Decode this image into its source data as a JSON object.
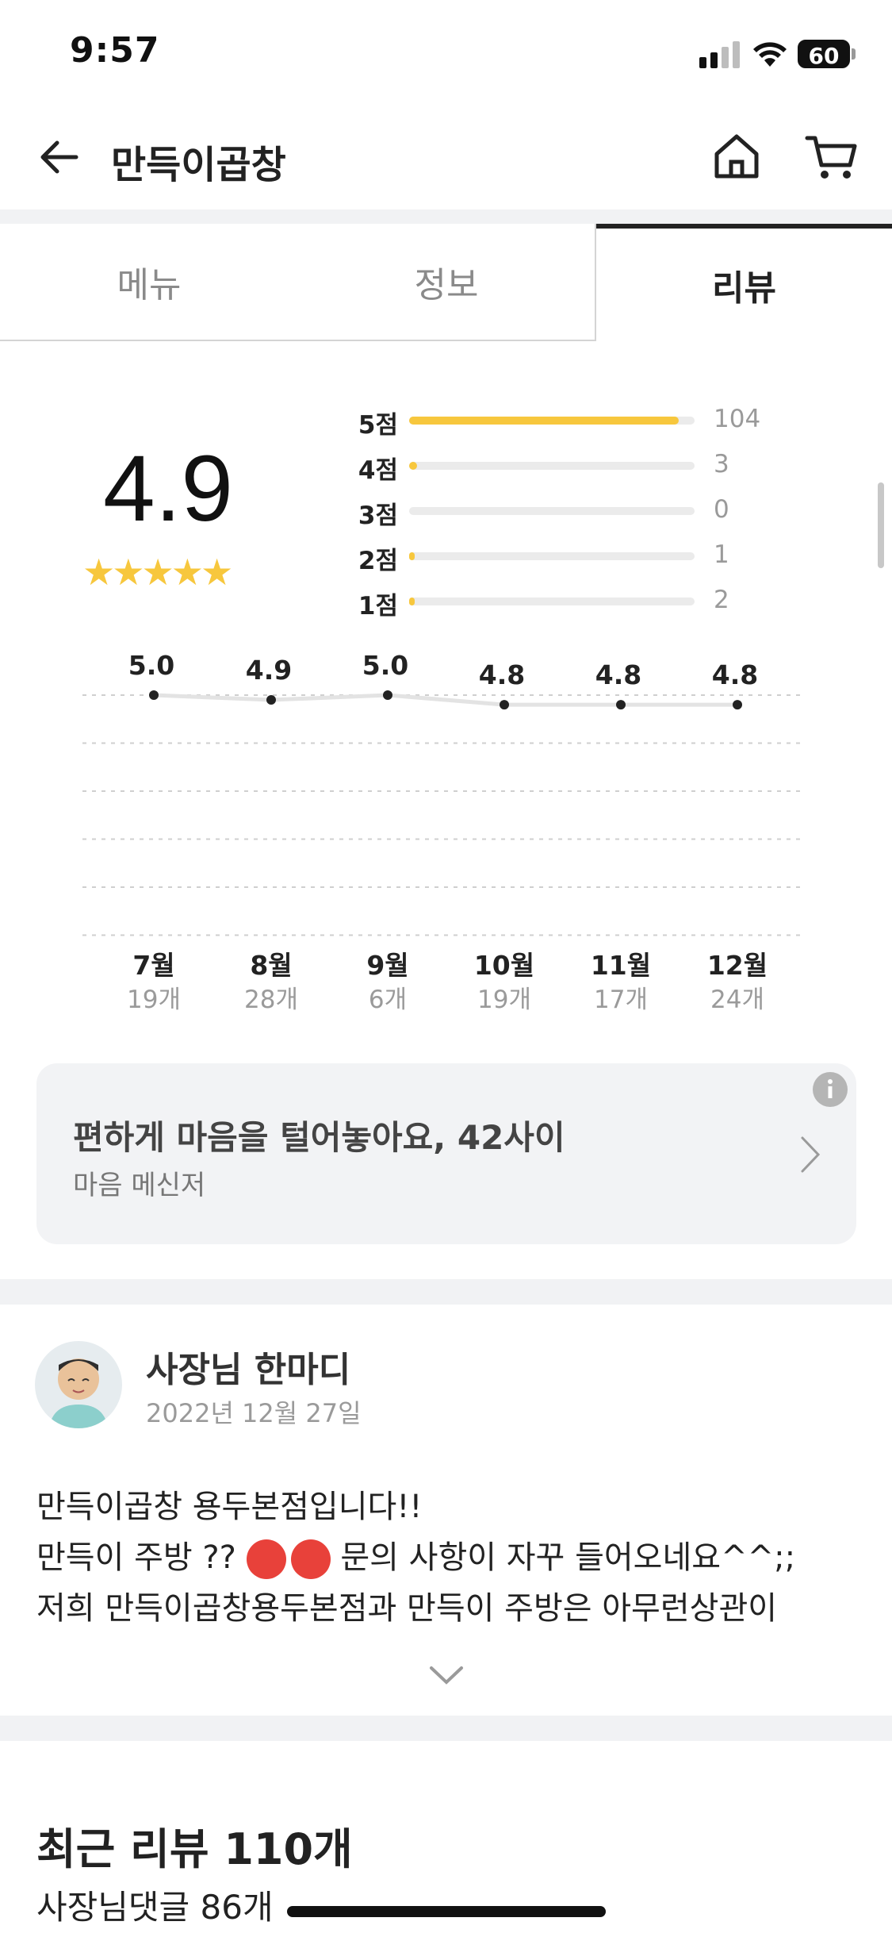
{
  "status_bar": {
    "time": "9:57",
    "battery": "60"
  },
  "header": {
    "title": "만득이곱창"
  },
  "tabs": [
    {
      "label": "메뉴"
    },
    {
      "label": "정보"
    },
    {
      "label": "리뷰"
    }
  ],
  "rating": {
    "score": "4.9",
    "stars": "★★★★★",
    "distribution": [
      {
        "label": "5점",
        "count": "104",
        "fraction": 0.945
      },
      {
        "label": "4점",
        "count": "3",
        "fraction": 0.027
      },
      {
        "label": "3점",
        "count": "0",
        "fraction": 0.0
      },
      {
        "label": "2점",
        "count": "1",
        "fraction": 0.009
      },
      {
        "label": "1점",
        "count": "2",
        "fraction": 0.018
      }
    ]
  },
  "chart_data": {
    "type": "line",
    "title": "",
    "categories": [
      "7월",
      "8월",
      "9월",
      "10월",
      "11월",
      "12월"
    ],
    "category_counts": [
      "19개",
      "28개",
      "6개",
      "19개",
      "17개",
      "24개"
    ],
    "values": [
      5.0,
      4.9,
      5.0,
      4.8,
      4.8,
      4.8
    ],
    "value_labels": [
      "5.0",
      "4.9",
      "5.0",
      "4.8",
      "4.8",
      "4.8"
    ],
    "ylim": [
      0,
      5
    ],
    "grid": true
  },
  "banner": {
    "title": "편하게 마음을 털어놓아요, 42사이",
    "subtitle": "마음 메신저"
  },
  "owner_note": {
    "title": "사장님 한마디",
    "date": "2022년 12월 27일",
    "line1": "만득이곱창 용두본점입니다!!",
    "line2_a": "만득이 주방 ??",
    "line2_b": "문의 사항이 자꾸 들어오네요^^;;",
    "line3": "저희 만득이곱창용두본점과 만득이 주방은 아무런상관이"
  },
  "recent_reviews": {
    "title": "최근 리뷰 110개",
    "owner_replies": "사장님댓글 86개"
  },
  "colors": {
    "accent": "#f7c73d",
    "text": "#222222",
    "muted": "#9a9a9a"
  }
}
